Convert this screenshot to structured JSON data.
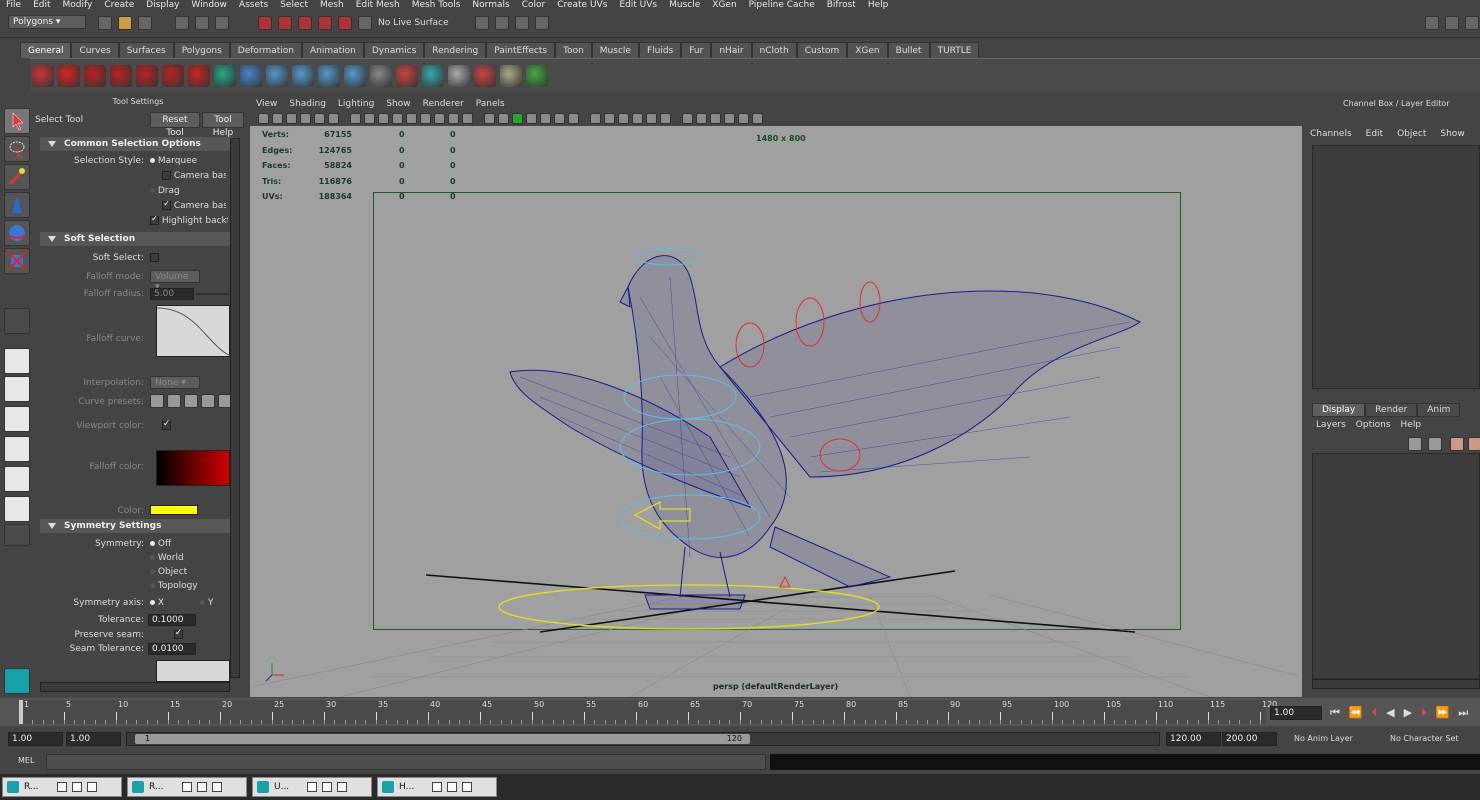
{
  "menubar": [
    "File",
    "Edit",
    "Modify",
    "Create",
    "Display",
    "Window",
    "Assets",
    "Select",
    "Mesh",
    "Edit Mesh",
    "Mesh Tools",
    "Normals",
    "Color",
    "Create UVs",
    "Edit UVs",
    "Muscle",
    "XGen",
    "Pipeline Cache",
    "Bifrost",
    "Help"
  ],
  "status": {
    "mode_dropdown": "Polygons",
    "live_surface": "No Live Surface"
  },
  "shelf_tabs": [
    "General",
    "Curves",
    "Surfaces",
    "Polygons",
    "Deformation",
    "Animation",
    "Dynamics",
    "Rendering",
    "PaintEffects",
    "Toon",
    "Muscle",
    "Fluids",
    "Fur",
    "nHair",
    "nCloth",
    "Custom",
    "XGen",
    "Bullet",
    "TURTLE"
  ],
  "tool_settings": {
    "header": "Tool Settings",
    "tool_name": "Select Tool",
    "reset": "Reset Tool",
    "help": "Tool Help",
    "common_header": "Common Selection Options",
    "selection_style_label": "Selection Style:",
    "marquee": "Marquee",
    "camera_based": "Camera based",
    "drag": "Drag",
    "camera_based2": "Camera based",
    "highlight": "Highlight backface",
    "soft_header": "Soft Selection",
    "soft_select": "Soft Select:",
    "falloff_mode": "Falloff mode:",
    "falloff_mode_val": "Volume",
    "falloff_radius": "Falloff radius:",
    "falloff_radius_val": "5.00",
    "falloff_curve": "Falloff curve:",
    "interpolation": "Interpolation:",
    "interpolation_val": "None",
    "curve_presets": "Curve presets:",
    "viewport_color": "Viewport color:",
    "falloff_color": "Falloff color:",
    "color": "Color:",
    "sym_header": "Symmetry Settings",
    "symmetry": "Symmetry:",
    "sym_off": "Off",
    "sym_world": "World",
    "sym_object": "Object",
    "sym_topology": "Topology",
    "sym_axis": "Symmetry axis:",
    "axis_x": "X",
    "axis_y": "Y",
    "tolerance": "Tolerance:",
    "tolerance_val": "0.1000",
    "preserve": "Preserve seam:",
    "seam_tol": "Seam Tolerance:",
    "seam_tol_val": "0.0100"
  },
  "viewport": {
    "menus": [
      "View",
      "Shading",
      "Lighting",
      "Show",
      "Renderer",
      "Panels"
    ],
    "hud_labels": [
      "Verts:",
      "Edges:",
      "Faces:",
      "Tris:",
      "UVs:"
    ],
    "hud_values": [
      "67155",
      "124765",
      "58824",
      "116876",
      "188364"
    ],
    "hud_zero": "0",
    "resolution": "1480 x 800",
    "camera_label": "persp (defaultRenderLayer)"
  },
  "channel_box": {
    "title": "Channel Box / Layer Editor",
    "menus": [
      "Channels",
      "Edit",
      "Object",
      "Show"
    ],
    "tabs": [
      "Display",
      "Render",
      "Anim"
    ],
    "layer_menus": [
      "Layers",
      "Options",
      "Help"
    ]
  },
  "timeline": {
    "ticks": [
      "1",
      "5",
      "10",
      "15",
      "20",
      "25",
      "30",
      "35",
      "40",
      "45",
      "50",
      "55",
      "60",
      "65",
      "70",
      "75",
      "80",
      "85",
      "90",
      "95",
      "100",
      "105",
      "110",
      "115",
      "120"
    ],
    "current": "1.00"
  },
  "range": {
    "start": "1.00",
    "start2": "1.00",
    "slider_start": "1",
    "slider_end": "120",
    "end": "120.00",
    "end2": "200.00",
    "anim_layer": "No Anim Layer",
    "char_set": "No Character Set"
  },
  "cmd": {
    "label": "MEL"
  },
  "taskbar": [
    {
      "label": "R..."
    },
    {
      "label": "R..."
    },
    {
      "label": "U..."
    },
    {
      "label": "H..."
    }
  ],
  "colors": {
    "wire": "#1b1b8a",
    "accent": "#e0e020",
    "falloff": "#d00000"
  }
}
